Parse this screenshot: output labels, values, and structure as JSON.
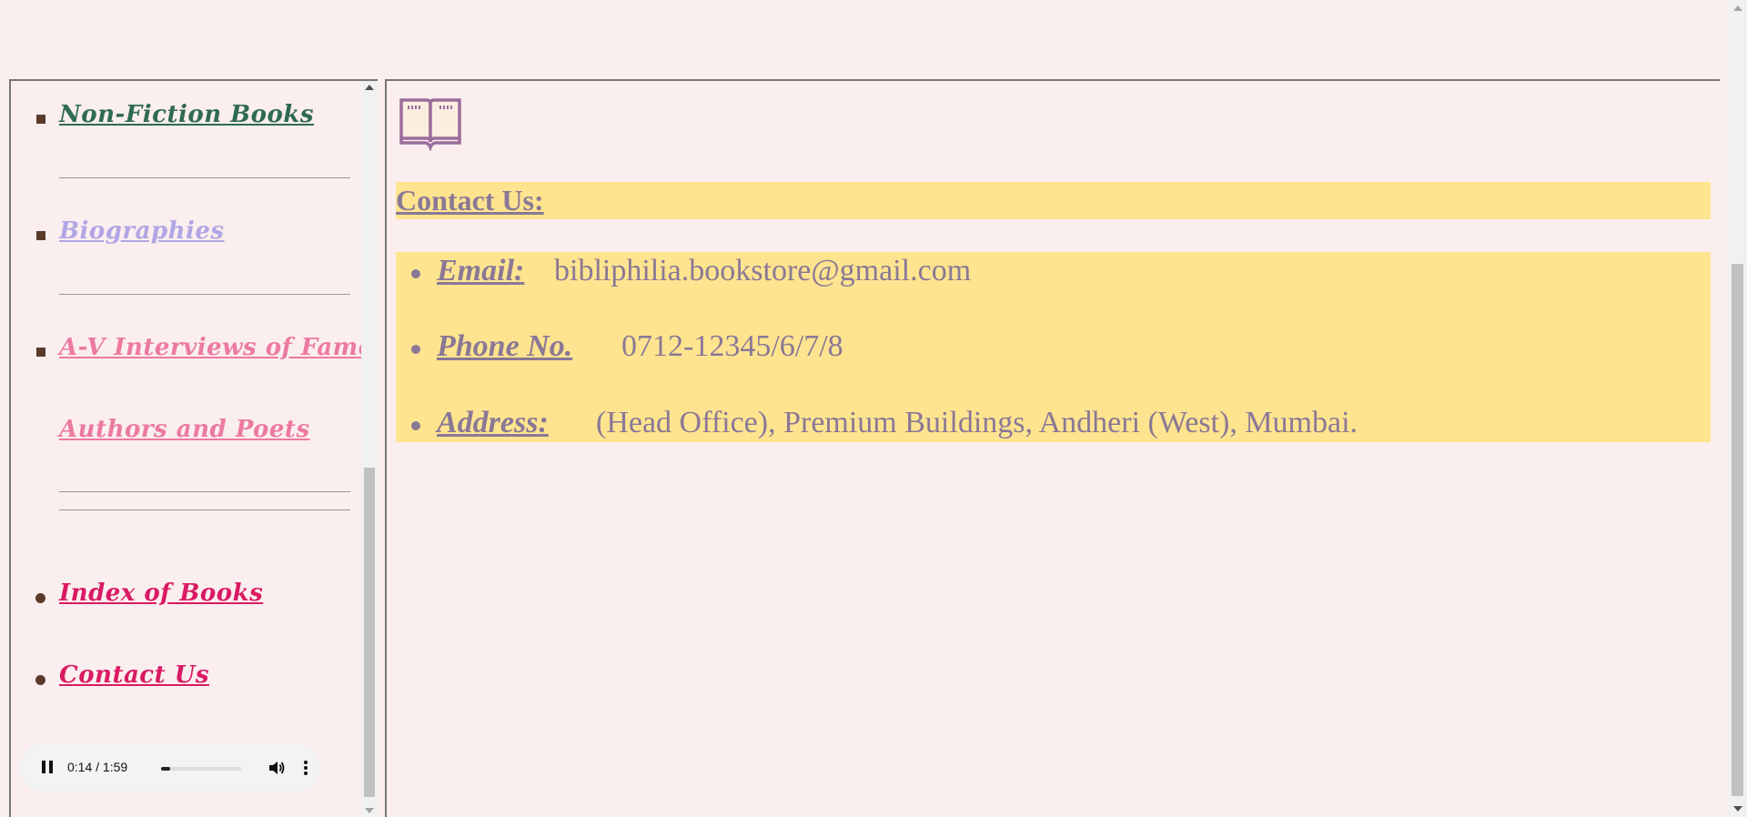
{
  "colors": {
    "page_background": "#fbeeee",
    "highlight_background": "#fee48f",
    "contact_text": "#8a7896",
    "bullet": "#5a3a2a"
  },
  "nav": {
    "items": [
      {
        "label": "Non-Fiction Books",
        "color": "#2f6b52",
        "bullet": "square"
      },
      {
        "label": "Biographies",
        "color": "#b1a6e4",
        "bullet": "square"
      },
      {
        "label_line1": "A-V Interviews of Famous",
        "label_line2": "Authors and Poets",
        "color": "#ec7aa0",
        "bullet": "square"
      },
      {
        "label": "Index of Books",
        "color": "#d91a63",
        "bullet": "disc"
      },
      {
        "label": "Contact Us",
        "color": "#d91a63",
        "bullet": "disc"
      }
    ]
  },
  "audio": {
    "time": "0:14 / 1:59",
    "progress_fraction": 0.118,
    "pause_icon": "pause-icon",
    "volume_icon": "volume-icon",
    "menu_icon": "more-vertical-icon"
  },
  "main": {
    "icon": "open-book-icon",
    "heading": "Contact Us:",
    "contacts": [
      {
        "label": "Email:",
        "value": "bibliphilia.bookstore@gmail.com"
      },
      {
        "label": "Phone No.",
        "value": "0712-12345/6/7/8"
      },
      {
        "label": "Address:",
        "value": "(Head Office), Premium Buildings, Andheri (West), Mumbai."
      }
    ]
  }
}
